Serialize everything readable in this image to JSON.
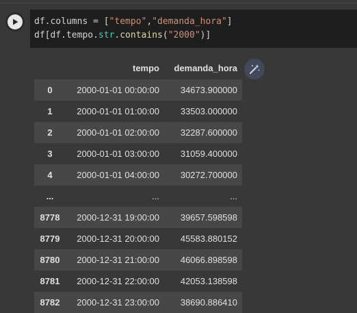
{
  "code": {
    "line1_prefix": "df.columns = [",
    "line1_str1": "\"tempo\"",
    "line1_comma": ",",
    "line1_str2": "\"demanda_hora\"",
    "line1_suffix": "]",
    "line2_prefix": "df[df.tempo.",
    "line2_str_attr": "str",
    "line2_dot": ".",
    "line2_contains": "contains",
    "line2_open": "(",
    "line2_arg": "\"2000\"",
    "line2_close": ")]"
  },
  "table": {
    "columns": [
      "",
      "tempo",
      "demanda_hora"
    ],
    "rows": [
      {
        "index": "0",
        "tempo": "2000-01-01 00:00:00",
        "demanda_hora": "34673.900000"
      },
      {
        "index": "1",
        "tempo": "2000-01-01 01:00:00",
        "demanda_hora": "33503.000000"
      },
      {
        "index": "2",
        "tempo": "2000-01-01 02:00:00",
        "demanda_hora": "32287.600000"
      },
      {
        "index": "3",
        "tempo": "2000-01-01 03:00:00",
        "demanda_hora": "31059.400000"
      },
      {
        "index": "4",
        "tempo": "2000-01-01 04:00:00",
        "demanda_hora": "30272.700000"
      },
      {
        "index": "...",
        "tempo": "...",
        "demanda_hora": "..."
      },
      {
        "index": "8778",
        "tempo": "2000-12-31 19:00:00",
        "demanda_hora": "39657.598598"
      },
      {
        "index": "8779",
        "tempo": "2000-12-31 20:00:00",
        "demanda_hora": "45583.880152"
      },
      {
        "index": "8780",
        "tempo": "2000-12-31 21:00:00",
        "demanda_hora": "46066.898598"
      },
      {
        "index": "8781",
        "tempo": "2000-12-31 22:00:00",
        "demanda_hora": "42053.138598"
      },
      {
        "index": "8782",
        "tempo": "2000-12-31 23:00:00",
        "demanda_hora": "38690.886410"
      }
    ]
  },
  "icons": {
    "run": "play-icon",
    "magic": "magic-wand-icon"
  },
  "colors": {
    "background": "#383838",
    "code_background": "#1e1e1e",
    "string": "#ce9178",
    "row_stripe": "#474747"
  }
}
